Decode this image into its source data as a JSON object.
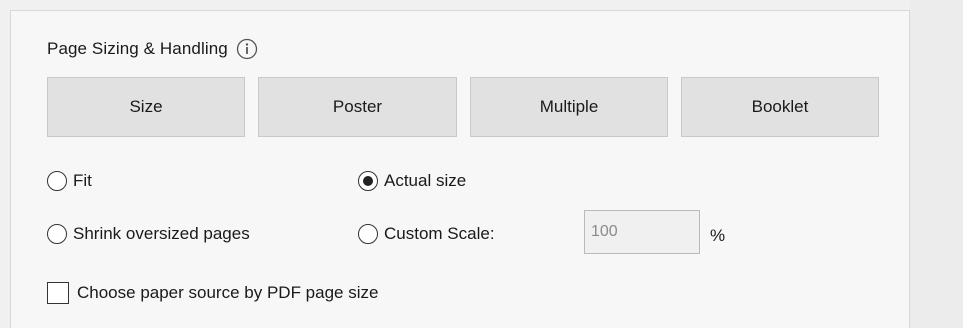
{
  "section": {
    "title": "Page Sizing & Handling"
  },
  "tabs": [
    {
      "label": "Size"
    },
    {
      "label": "Poster"
    },
    {
      "label": "Multiple"
    },
    {
      "label": "Booklet"
    }
  ],
  "options": {
    "fit": {
      "label": "Fit",
      "selected": false
    },
    "actual_size": {
      "label": "Actual size",
      "selected": true
    },
    "shrink": {
      "label": "Shrink oversized pages",
      "selected": false
    },
    "custom_scale": {
      "label": "Custom Scale:",
      "selected": false,
      "value": "100",
      "unit": "%"
    }
  },
  "paper_source": {
    "label": "Choose paper source by PDF page size",
    "checked": false
  },
  "icons": {
    "info": "info-circle-icon"
  }
}
